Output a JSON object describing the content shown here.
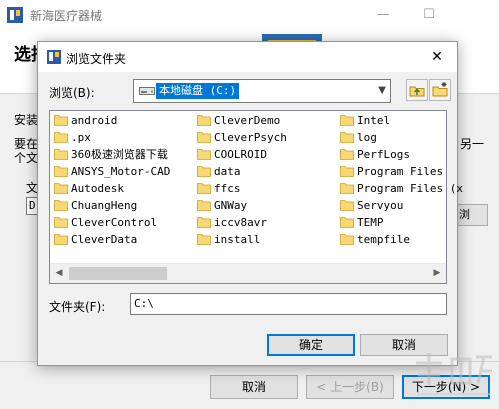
{
  "installer": {
    "title": "新海医疗器械",
    "heading": "选择安装文件夹",
    "install_text_1": "安装程",
    "install_text_2": "要在",
    "install_text_3": "个文",
    "install_text_right": "另一",
    "folder_label": "文件",
    "path_value": "D:",
    "browse_label": "浏",
    "cancel_label": "取消",
    "back_label": "< 上一步(B)",
    "next_label": "下一步(N) >"
  },
  "dialog": {
    "title": "浏览文件夹",
    "look_in_label": "浏览(B):",
    "drive_label": "本地磁盘 (C:)",
    "folder_label": "文件夹(F):",
    "folder_value": "C:\\",
    "ok_label": "确定",
    "cancel_label": "取消"
  },
  "folders": {
    "col1": [
      "android",
      ".px",
      "360极速浏览器下载",
      "ANSYS_Motor-CAD",
      "Autodesk",
      "ChuangHeng",
      "CleverControl",
      "CleverData"
    ],
    "col2": [
      "CleverDemo",
      "CleverPsych",
      "COOLROID",
      "data",
      "ffcs",
      "GNWay",
      "iccv8avr",
      "install"
    ],
    "col3": [
      "Intel",
      "log",
      "PerfLogs",
      "Program Files",
      "Program Files (x",
      "Servyou",
      "TEMP",
      "tempfile"
    ]
  },
  "colors": {
    "accent": "#0078d7",
    "folder": "#f8d775",
    "folder_edge": "#c9a227"
  },
  "icons": {
    "app": "installer-app-icon",
    "drive": "hard-drive-icon",
    "folder": "folder-icon",
    "up": "up-folder-icon",
    "new": "new-folder-icon"
  }
}
